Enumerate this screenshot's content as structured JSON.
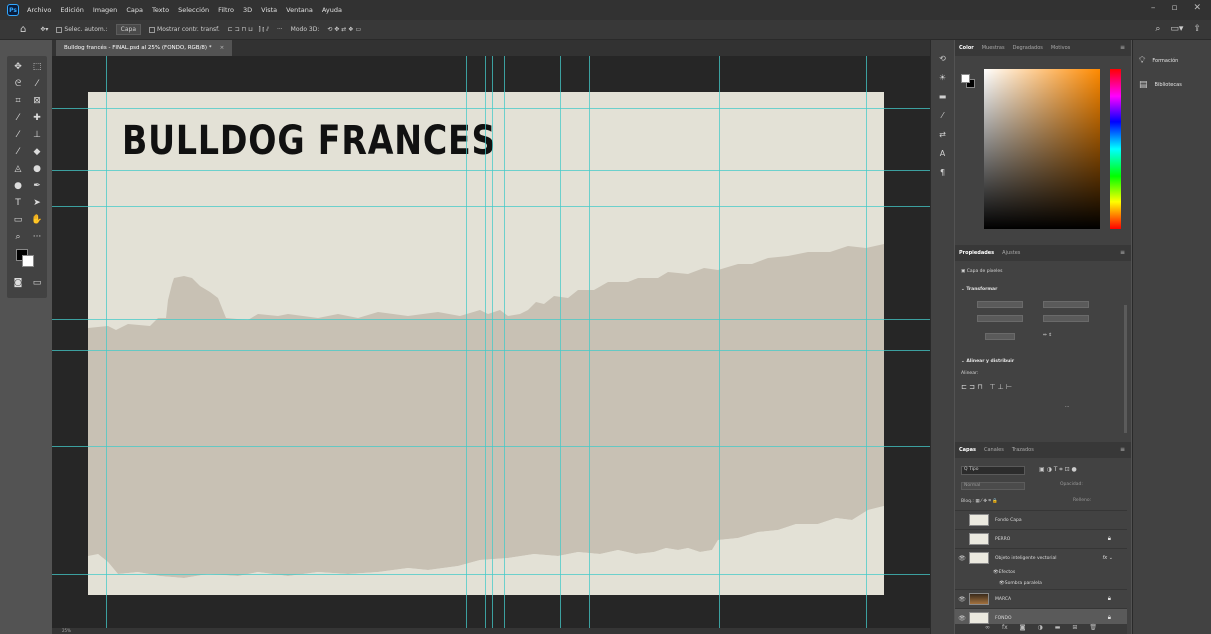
{
  "app": {
    "logo": "Ps",
    "menu": [
      "Archivo",
      "Edición",
      "Imagen",
      "Capa",
      "Texto",
      "Selección",
      "Filtro",
      "3D",
      "Vista",
      "Ventana",
      "Ayuda"
    ],
    "window_controls": [
      "–",
      "▫",
      "✕"
    ]
  },
  "options_bar": {
    "home_icon": "home-icon",
    "auto_select_label": "Selec. autom.:",
    "auto_select_value": "Capa",
    "transform_controls_label": "Mostrar contr. transf.",
    "mode_3d_label": "Modo 3D:",
    "more_label": "···"
  },
  "document": {
    "tab_title": "Bulldog francés - FINAL.psd al 25% (FONDO, RGB/8) *",
    "tab_close": "×",
    "artboard_title": "BULLDOG FRANCES",
    "status": "25%",
    "colors": {
      "artboard_bg": "#e3e1d6",
      "shape_fill": "#c8c1b4",
      "guides": "#44c9c8"
    }
  },
  "panels": {
    "color_tabs": [
      "Color",
      "Muestras",
      "Degradados",
      "Motivos"
    ],
    "properties_tabs": [
      "Propiedades",
      "Ajustes"
    ],
    "properties": {
      "layer_type": "Capa de píxeles",
      "transform_heading": "Transformar",
      "align_heading": "Alinear y distribuir",
      "align_label": "Alinear:"
    },
    "layers_tabs": [
      "Capas",
      "Canales",
      "Trazados"
    ],
    "layers": {
      "filter_label": "Q Tipo",
      "blend_mode": "Normal",
      "opacity_label": "Opacidad:",
      "lock_label": "Bloq.:",
      "fill_label": "Relleno:",
      "items": [
        {
          "name": "Fondo Capa",
          "thumb": "light",
          "eye": false,
          "lock": false,
          "fx": false,
          "sub": false,
          "selected": false
        },
        {
          "name": "PERRO",
          "thumb": "light",
          "eye": false,
          "lock": true,
          "fx": false,
          "sub": false,
          "selected": false
        },
        {
          "name": "Objeto inteligente vectorial",
          "thumb": "light",
          "eye": true,
          "lock": false,
          "fx": true,
          "sub": false,
          "selected": false
        },
        {
          "name": "Efectos",
          "thumb": "none",
          "eye": false,
          "lock": false,
          "fx": false,
          "sub": true,
          "selected": false
        },
        {
          "name": "Sombra paralela",
          "thumb": "none",
          "eye": false,
          "lock": false,
          "fx": false,
          "sub": true,
          "selected": false
        },
        {
          "name": "MARCA",
          "thumb": "dark",
          "eye": true,
          "lock": true,
          "fx": false,
          "sub": false,
          "selected": false
        },
        {
          "name": "FONDO",
          "thumb": "light",
          "eye": true,
          "lock": true,
          "fx": false,
          "sub": false,
          "selected": true
        }
      ]
    }
  },
  "far_right": {
    "items": [
      {
        "icon": "bulb-icon",
        "label": "Formación"
      },
      {
        "icon": "library-icon",
        "label": "Bibliotecas"
      }
    ]
  }
}
